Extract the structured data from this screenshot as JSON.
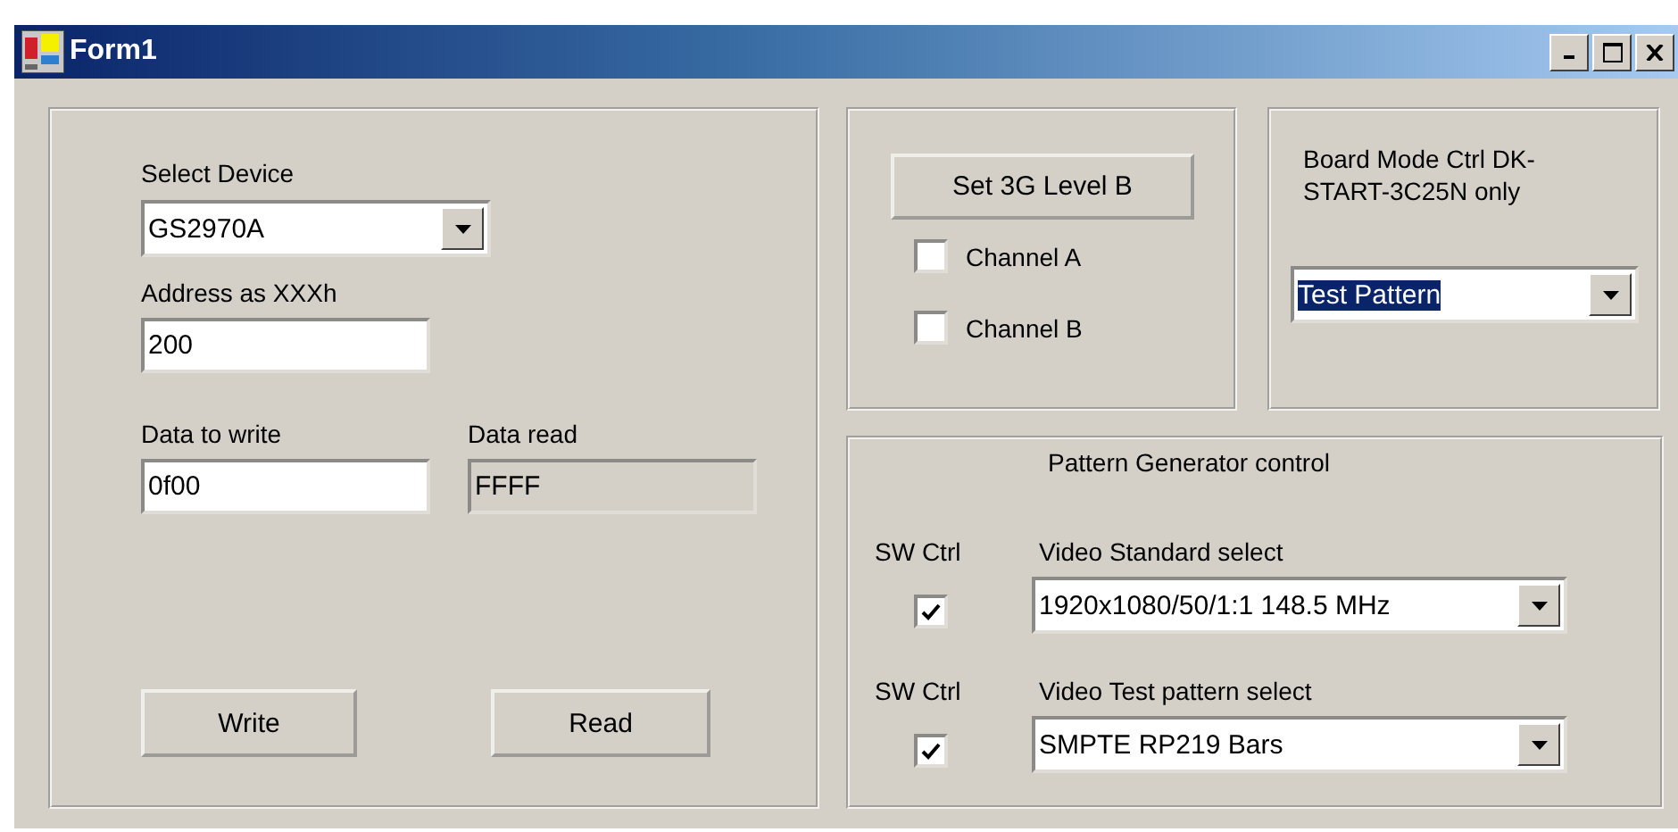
{
  "window": {
    "title": "Form1"
  },
  "register_panel": {
    "device": {
      "label": "Select Device",
      "value": "GS2970A"
    },
    "address": {
      "label": "Address as XXXh",
      "value": "200"
    },
    "data_write": {
      "label": "Data to write",
      "value": "0f00",
      "disabled": false
    },
    "data_read": {
      "label": "Data read",
      "value": "FFFF",
      "disabled": true
    },
    "buttons": [
      "Write",
      "Read"
    ]
  },
  "level_panel": {
    "button": "Set 3G Level B",
    "channels": [
      {
        "label": "Channel A",
        "checked": false
      },
      {
        "label": "Channel B",
        "checked": false
      }
    ]
  },
  "board_mode": {
    "label_lines": [
      "Board Mode Ctrl DK-",
      "START-3C25N only"
    ],
    "value": "Test Pattern",
    "highlighted": true
  },
  "pattern_generator": {
    "title": "Pattern Generator control",
    "rows": [
      {
        "sw_label": "SW Ctrl",
        "sw_checked": true,
        "label": "Video Standard select",
        "value": "1920x1080/50/1:1 148.5 MHz"
      },
      {
        "sw_label": "SW Ctrl",
        "sw_checked": true,
        "label": "Video Test pattern select",
        "value": "SMPTE RP219 Bars"
      }
    ]
  }
}
